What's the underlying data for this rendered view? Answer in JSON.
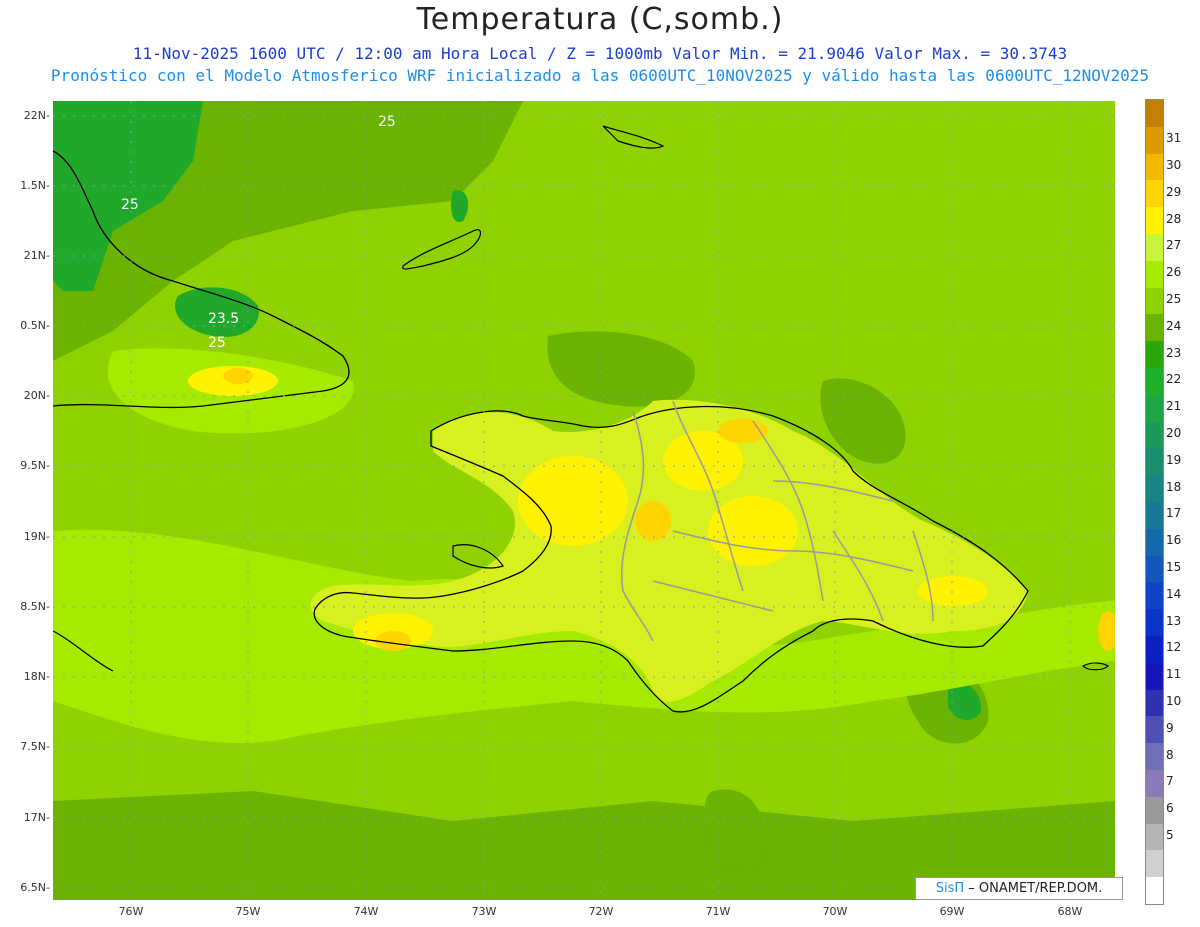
{
  "header": {
    "title": "Temperatura (C,somb.)",
    "subtitle_1": "11-Nov-2025 1600 UTC / 12:00 am Hora Local / Z = 1000mb  Valor Min. = 21.9046  Valor Max. = 30.3743",
    "subtitle_2": "Pronóstico con el Modelo Atmosferico WRF inicializado a las 0600UTC_10NOV2025 y válido hasta las  0600UTC_12NOV2025"
  },
  "credit": {
    "brand": "SisΠ",
    "text": " – ONAMET/REP.DOM."
  },
  "chart_data": {
    "type": "heatmap",
    "title": "Temperatura (C,somb.)",
    "variable": "Temperatura",
    "units": "C",
    "level": "1000mb",
    "valid_time": "11-Nov-2025 1600 UTC",
    "local_time": "12:00 am Hora Local",
    "min_value": 21.9046,
    "max_value": 30.3743,
    "init": "0600UTC_10NOV2025",
    "valid_until": "0600UTC_12NOV2025",
    "x_axis": {
      "ticks": [
        "76W",
        "75W",
        "74W",
        "73W",
        "72W",
        "71W",
        "70W",
        "69W",
        "68W"
      ],
      "lim": [
        -76.65,
        -67.6
      ]
    },
    "y_axis": {
      "ticks": [
        "22N",
        "1.5N",
        "21N",
        "0.5N",
        "20N",
        "9.5N",
        "19N",
        "8.5N",
        "18N",
        "7.5N",
        "17N",
        "6.5N"
      ],
      "lim": [
        16.45,
        22.1
      ]
    },
    "grid": true,
    "contour_labels": [
      "25",
      "25",
      "23.5",
      "25"
    ],
    "colorbar": {
      "labels": [
        "31",
        "30",
        "29",
        "28",
        "27",
        "26",
        "25",
        "24",
        "23",
        "22",
        "21",
        "20",
        "19",
        "18",
        "17",
        "16",
        "15",
        "14",
        "13",
        "12",
        "11",
        "10",
        "9",
        "8",
        "7",
        "6",
        "5"
      ],
      "colors": [
        "#c27f00",
        "#dd9900",
        "#f5b800",
        "#ffd400",
        "#fff200",
        "#c8f53a",
        "#a6ea00",
        "#8fd200",
        "#6ab300",
        "#2aa80a",
        "#1fb02a",
        "#1ea545",
        "#1c9a5c",
        "#1a8f70",
        "#188484",
        "#177a94",
        "#1569a8",
        "#1257bc",
        "#0f44c8",
        "#0c33c8",
        "#0b1fc4",
        "#1515b8",
        "#3030b0",
        "#5050b4",
        "#7070b8",
        "#8a7ab6",
        "#9a9a9a",
        "#b4b4b4",
        "#d0d0d0",
        "#ffffff"
      ]
    }
  }
}
